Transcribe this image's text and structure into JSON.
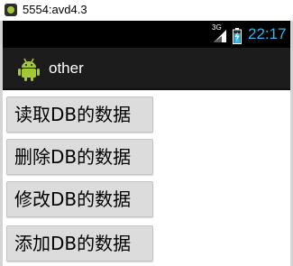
{
  "window": {
    "title": "5554:avd4.3",
    "icon": "android-emulator-icon"
  },
  "status_bar": {
    "network": "3G",
    "signal_icon": "signal-strength-icon",
    "battery_icon": "battery-charging-icon",
    "time": "22:17",
    "accent_color": "#33b5e5"
  },
  "action_bar": {
    "icon": "android-robot-icon",
    "title": "other"
  },
  "buttons": [
    {
      "label": "读取DB的数据"
    },
    {
      "label": "删除DB的数据"
    },
    {
      "label": "修改DB的数据"
    },
    {
      "label": "添加DB的数据"
    }
  ]
}
